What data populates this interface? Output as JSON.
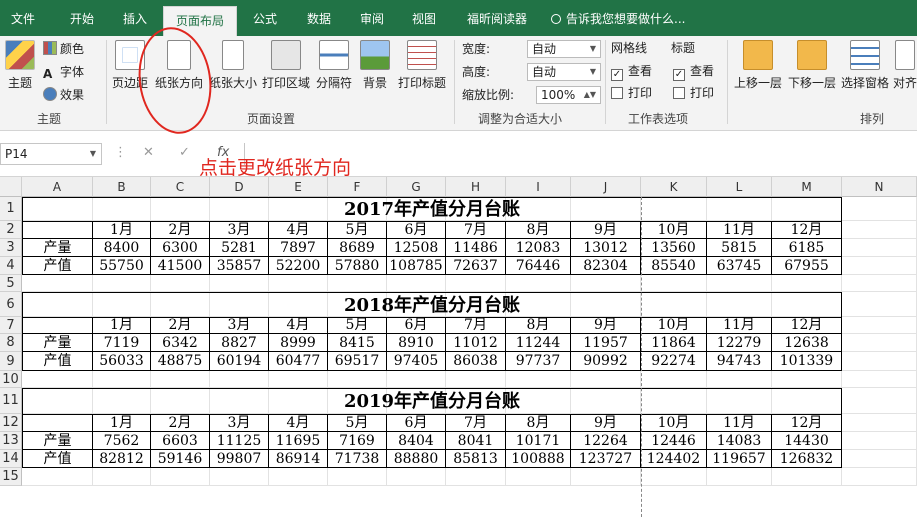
{
  "tabs": [
    "文件",
    "开始",
    "插入",
    "页面布局",
    "公式",
    "数据",
    "审阅",
    "视图",
    "福昕阅读器"
  ],
  "active_tab": "页面布局",
  "tell_me": "告诉我您想要做什么...",
  "ribbon": {
    "theme": {
      "main": "主题",
      "colors": "颜色",
      "fonts": "字体",
      "effects": "效果",
      "group": "主题"
    },
    "page_setup": {
      "margins": "页边距",
      "orientation": "纸张方向",
      "size": "纸张大小",
      "print_area": "打印区域",
      "breaks": "分隔符",
      "background": "背景",
      "print_titles": "打印标题",
      "group": "页面设置"
    },
    "scale_to_fit": {
      "width_label": "宽度:",
      "width_value": "自动",
      "height_label": "高度:",
      "height_value": "自动",
      "scale_label": "缩放比例:",
      "scale_value": "100%",
      "group": "调整为合适大小"
    },
    "sheet_options": {
      "gridlines": "网格线",
      "headings": "标题",
      "view": "查看",
      "print": "打印",
      "group": "工作表选项"
    },
    "arrange": {
      "bring_forward": "上移一层",
      "send_backward": "下移一层",
      "selection_pane": "选择窗格",
      "align": "对齐",
      "group": "排列"
    }
  },
  "formula_bar": {
    "name_box": "P14",
    "fx": "fx",
    "formula": ""
  },
  "annotation": "点击更改纸张方向",
  "columns": [
    "A",
    "B",
    "C",
    "D",
    "E",
    "F",
    "G",
    "H",
    "I",
    "J",
    "K",
    "L",
    "M",
    "N"
  ],
  "rows": [
    "1",
    "2",
    "3",
    "4",
    "5",
    "6",
    "7",
    "8",
    "9",
    "10",
    "11",
    "12",
    "13",
    "14",
    "15"
  ],
  "tables": [
    {
      "title": "2017年产值分月台账",
      "months": [
        "1月",
        "2月",
        "3月",
        "4月",
        "5月",
        "6月",
        "7月",
        "8月",
        "9月",
        "10月",
        "11月",
        "12月"
      ],
      "label_yield": "产量",
      "label_value": "产值",
      "yield": [
        "8400",
        "6300",
        "5281",
        "7897",
        "8689",
        "12508",
        "11486",
        "12083",
        "13012",
        "13560",
        "5815",
        "6185"
      ],
      "value": [
        "55750",
        "41500",
        "35857",
        "52200",
        "57880",
        "108785",
        "72637",
        "76446",
        "82304",
        "85540",
        "63745",
        "67955"
      ]
    },
    {
      "title": "2018年产值分月台账",
      "months": [
        "1月",
        "2月",
        "3月",
        "4月",
        "5月",
        "6月",
        "7月",
        "8月",
        "9月",
        "10月",
        "11月",
        "12月"
      ],
      "label_yield": "产量",
      "label_value": "产值",
      "yield": [
        "7119",
        "6342",
        "8827",
        "8999",
        "8415",
        "8910",
        "11012",
        "11244",
        "11957",
        "11864",
        "12279",
        "12638"
      ],
      "value": [
        "56033",
        "48875",
        "60194",
        "60477",
        "69517",
        "97405",
        "86038",
        "97737",
        "90992",
        "92274",
        "94743",
        "101339"
      ]
    },
    {
      "title": "2019年产值分月台账",
      "months": [
        "1月",
        "2月",
        "3月",
        "4月",
        "5月",
        "6月",
        "7月",
        "8月",
        "9月",
        "10月",
        "11月",
        "12月"
      ],
      "label_yield": "产量",
      "label_value": "产值",
      "yield": [
        "7562",
        "6603",
        "11125",
        "11695",
        "7169",
        "8404",
        "8041",
        "10171",
        "12264",
        "12446",
        "14083",
        "14430"
      ],
      "value": [
        "82812",
        "59146",
        "99807",
        "86914",
        "71738",
        "88880",
        "85813",
        "100888",
        "123727",
        "124402",
        "119657",
        "126832"
      ]
    }
  ]
}
